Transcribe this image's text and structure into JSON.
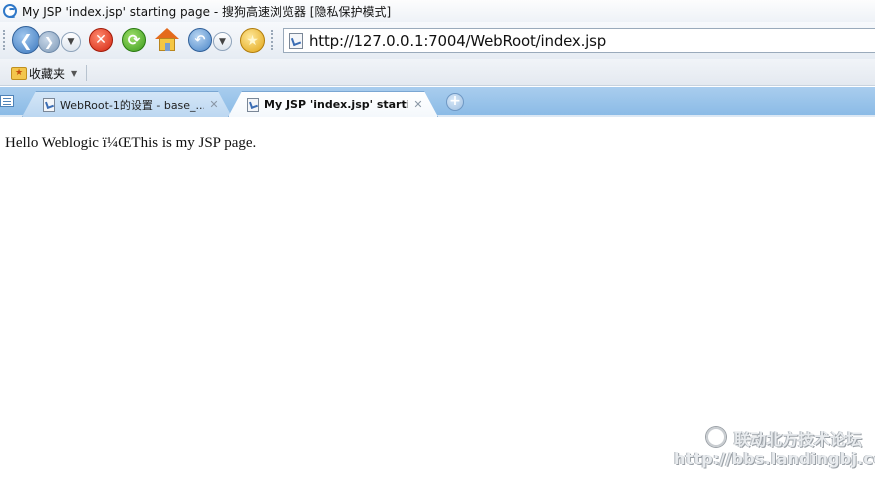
{
  "window": {
    "title": "My JSP 'index.jsp' starting page - 搜狗高速浏览器 [隐私保护模式]"
  },
  "toolbar": {
    "back_icon": "back-arrow",
    "forward_icon": "forward-arrow",
    "stop_icon": "close-x",
    "refresh_icon": "refresh",
    "home_icon": "house",
    "undo_icon": "undo-arrow",
    "favorite_icon": "star"
  },
  "address": {
    "url": "http://127.0.0.1:7004/WebRoot/index.jsp"
  },
  "favorites_bar": {
    "label": "收藏夹"
  },
  "tabs": [
    {
      "label": "WebRoot-1的设置 - base_...",
      "active": false
    },
    {
      "label": "My JSP 'index.jsp' starti...",
      "active": true
    }
  ],
  "page": {
    "text": "Hello Weblogic ï¼ŒThis is my JSP page."
  },
  "watermark": {
    "title": "联动北方技术论坛",
    "url": "http://bbs.landingbj.com"
  }
}
